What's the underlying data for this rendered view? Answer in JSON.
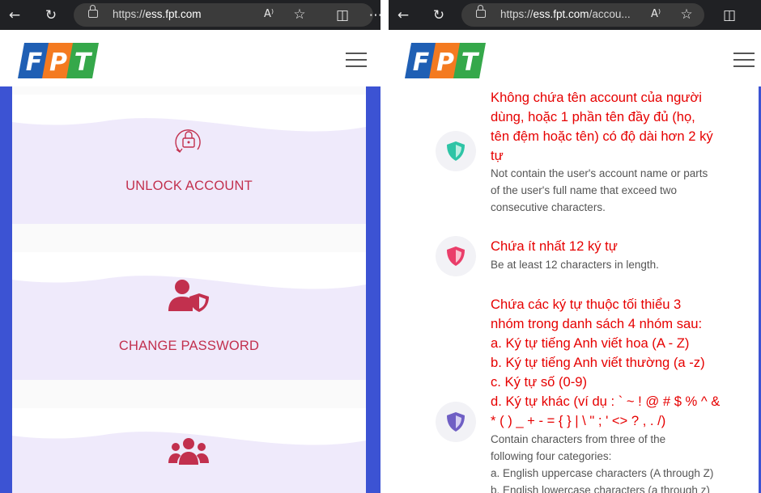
{
  "left_window": {
    "url_host": "ess.fpt.com",
    "url_prefix": "https://",
    "url_suffix": "",
    "logo_alt": "FPT",
    "cards": [
      {
        "label": "UNLOCK ACCOUNT",
        "icon": "unlock-account-icon"
      },
      {
        "label": "CHANGE PASSWORD",
        "icon": "user-shield-icon"
      },
      {
        "label": "",
        "icon": "users-group-icon"
      }
    ]
  },
  "right_window": {
    "url_prefix": "https://",
    "url_host": "ess.fpt.com",
    "url_suffix": "/accou...",
    "rules": [
      {
        "vi_lines": [
          "Không chứa tên account của người",
          "dùng, hoặc 1 phần tên đầy đủ (họ,",
          "tên đệm hoặc tên) có độ dài hơn 2 ký",
          "tự"
        ],
        "en_lines": [
          "Not contain the user's account name or parts",
          "of the user's full name that exceed two",
          "consecutive characters."
        ],
        "icon_color": "#2ec4a6"
      },
      {
        "vi_lines": [
          "Chứa ít nhất 12 ký tự"
        ],
        "en_lines": [
          "Be at least 12 characters in length."
        ],
        "icon_color": "#ea3e6a"
      },
      {
        "vi_lines": [
          "Chứa các ký tự thuộc tối thiểu 3",
          "nhóm trong danh sách 4 nhóm sau:",
          "a. Ký tự tiếng Anh viết hoa (A - Z)",
          "b. Ký tự tiếng Anh viết thường (a -z)",
          "c. Ký tự số (0-9)",
          "d. Ký tự khác (ví dụ : ` ~ ! @ # $ % ^ &",
          "* ( ) _ + - = { } | \\ \" ; ' <> ? , . /)"
        ],
        "en_lines": [
          "Contain characters from three of the",
          "following four categories:",
          "a. English uppercase characters (A through Z)",
          "b. English lowercase characters (a through z)"
        ],
        "icon_color": "#6f5fc4"
      }
    ]
  },
  "colors": {
    "brand_blue": "#3c53d3",
    "card_text": "#c2304e",
    "rule_vi": "#e60000"
  }
}
